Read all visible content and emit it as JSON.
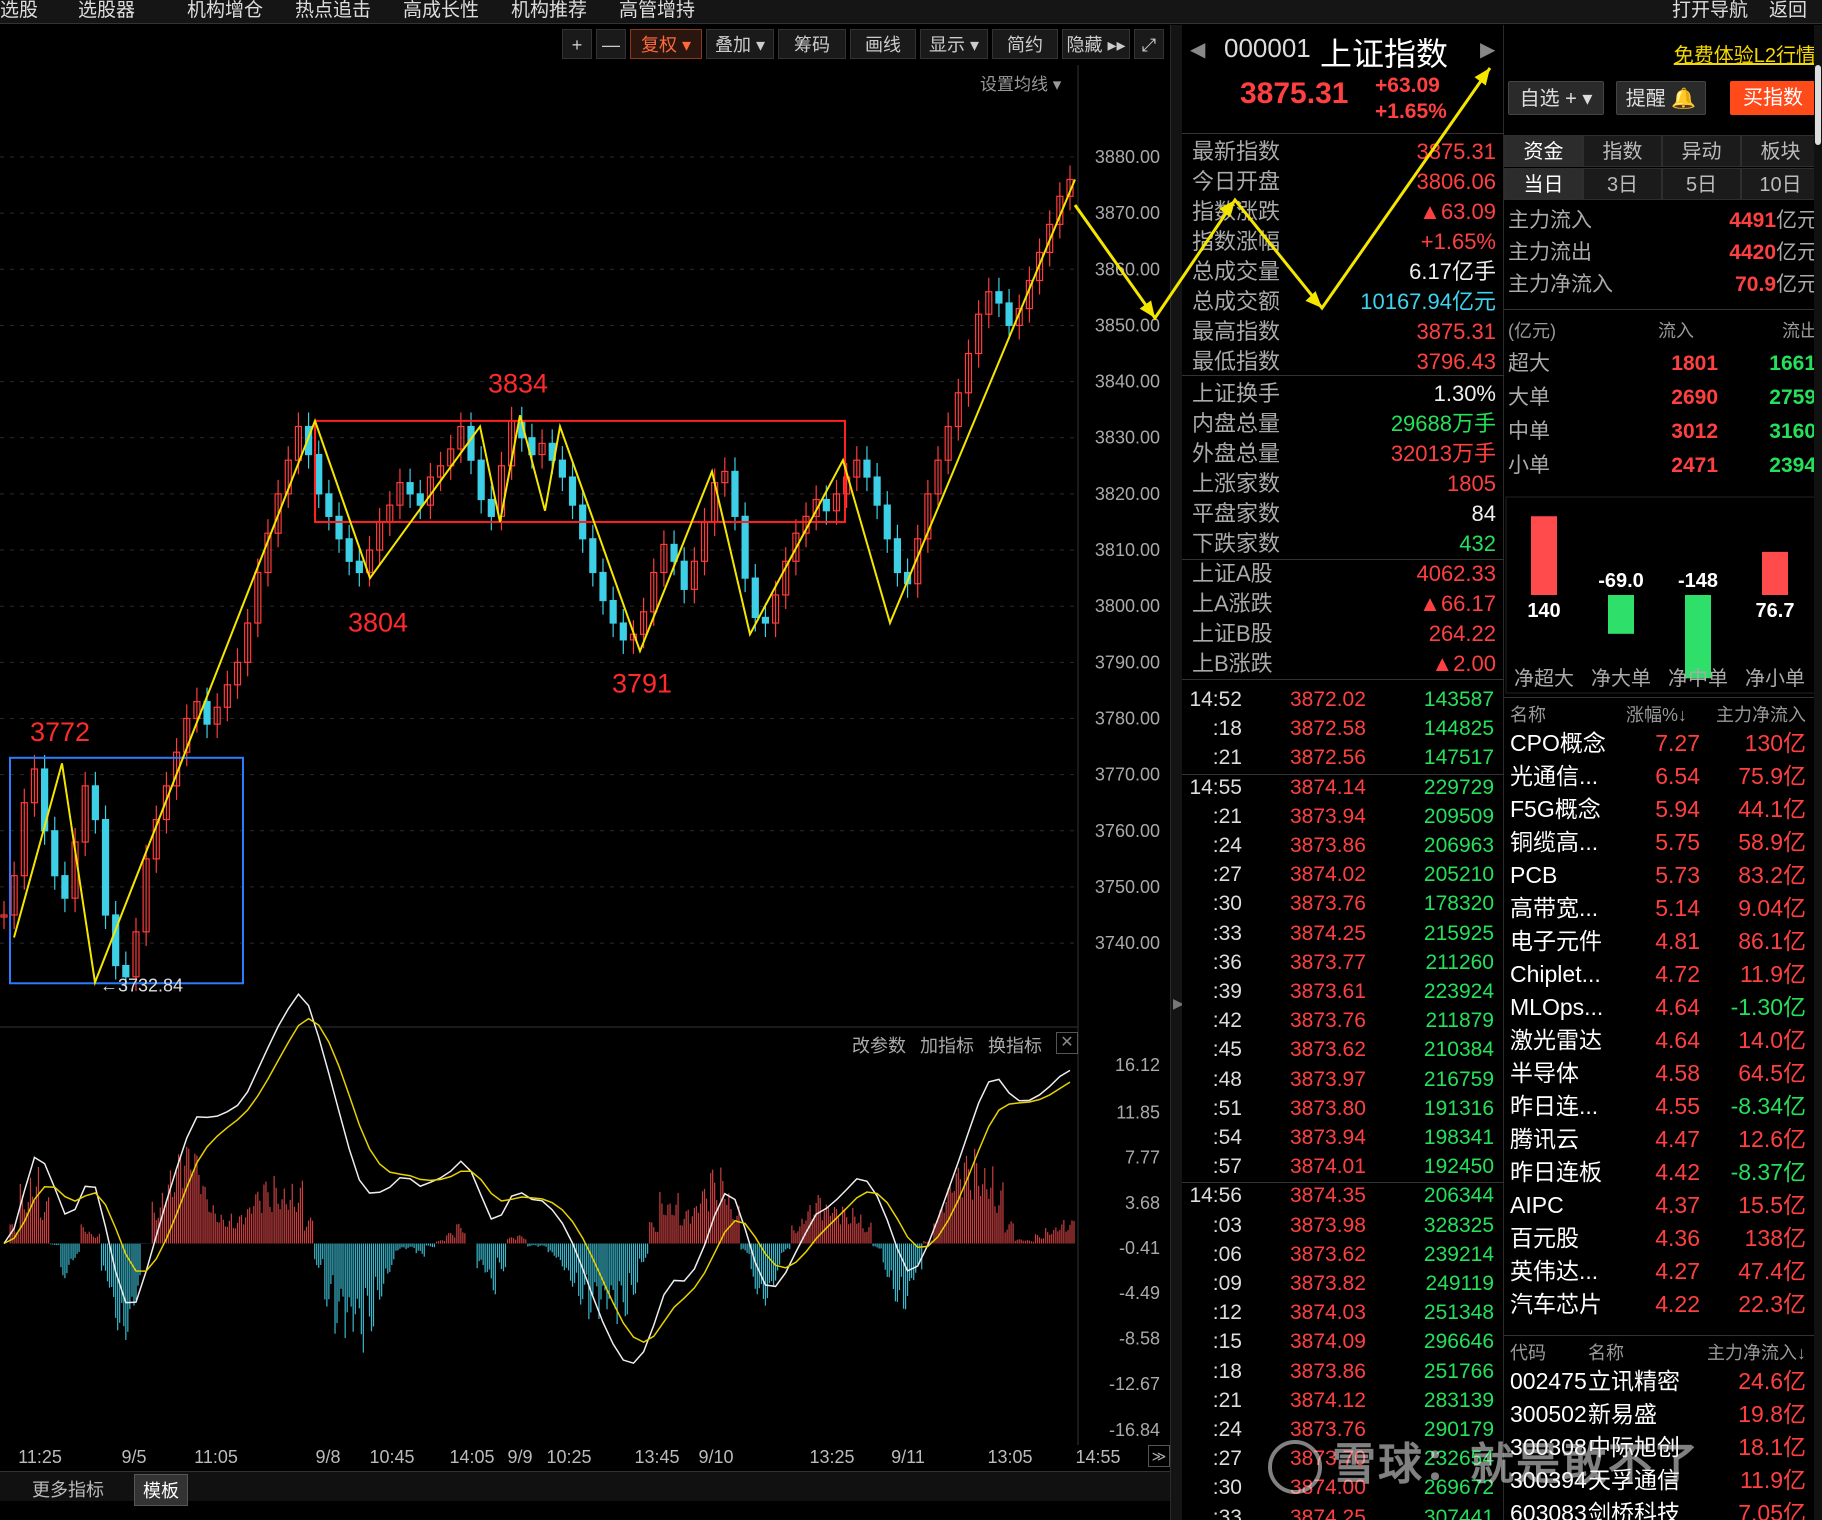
{
  "nav": {
    "items": [
      "选股",
      "选股器",
      "机构增仓",
      "热点追击",
      "高成长性",
      "机构推荐",
      "高管增持"
    ],
    "right": [
      "打开导航",
      "返回"
    ]
  },
  "toolbar": {
    "plus": "+",
    "minus": "—",
    "fuquan": "复权 ▾",
    "overlay": "叠加 ▾",
    "chips": "筹码",
    "draw": "画线",
    "display": "显示 ▾",
    "simple": "简约",
    "hide": "隐藏 ▸▸",
    "ma_settings": "设置均线 ▾"
  },
  "indicator_bar": {
    "edit": "改参数",
    "add": "加指标",
    "swap": "换指标"
  },
  "bottom_tabs": {
    "more": "更多指标",
    "template": "模板"
  },
  "chart_data": [
    {
      "type": "candlestick",
      "price_axis_ticks": [
        "3880.00",
        "3870.00",
        "3860.00",
        "3850.00",
        "3840.00",
        "3830.00",
        "3820.00",
        "3810.00",
        "3800.00",
        "3790.00",
        "3780.00",
        "3770.00",
        "3760.00",
        "3750.00",
        "3740.00"
      ],
      "ylim": [
        3732,
        3880
      ],
      "time_axis_labels": [
        "11:25",
        "9/5",
        "11:05",
        "9/8",
        "10:45",
        "14:05",
        "9/9",
        "10:25",
        "13:45",
        "9/10",
        "13:25",
        "9/11",
        "13:05",
        "14:55"
      ],
      "min_marker": "3732.84",
      "annotations": [
        "3772",
        "3834",
        "3804",
        "3791"
      ],
      "pivot_points": [
        3741,
        3772,
        3733,
        3833,
        3805,
        3832,
        3815,
        3834,
        3817,
        3832,
        3792,
        3824,
        3795,
        3826,
        3797,
        3876,
        3860,
        3866,
        3858,
        3880
      ],
      "price_series": [
        3745,
        3752,
        3765,
        3771,
        3760,
        3752,
        3748,
        3758,
        3768,
        3762,
        3745,
        3736,
        3734,
        3742,
        3755,
        3762,
        3768,
        3774,
        3780,
        3783,
        3779,
        3782,
        3786,
        3790,
        3797,
        3806,
        3813,
        3820,
        3826,
        3832,
        3827,
        3820,
        3816,
        3812,
        3808,
        3806,
        3810,
        3815,
        3818,
        3822,
        3820,
        3818,
        3823,
        3825,
        3828,
        3832,
        3826,
        3819,
        3816,
        3825,
        3833,
        3830,
        3827,
        3829,
        3826,
        3823,
        3818,
        3812,
        3806,
        3801,
        3797,
        3794,
        3795,
        3799,
        3806,
        3811,
        3808,
        3803,
        3808,
        3815,
        3822,
        3824,
        3816,
        3805,
        3798,
        3797,
        3802,
        3808,
        3813,
        3816,
        3819,
        3817,
        3820,
        3823,
        3826,
        3823,
        3818,
        3812,
        3806,
        3804,
        3812,
        3820,
        3826,
        3832,
        3838,
        3845,
        3852,
        3856,
        3854,
        3850,
        3853,
        3858,
        3863,
        3868,
        3873,
        3876
      ]
    },
    {
      "type": "macd",
      "axis_ticks": [
        "16.12",
        "11.85",
        "7.77",
        "3.68",
        "-0.41",
        "-4.49",
        "-8.58",
        "-12.67",
        "-16.84"
      ],
      "ylim": [
        -16.84,
        16.12
      ]
    },
    {
      "type": "bar",
      "title": "",
      "categories": [
        "净超大",
        "净大单",
        "净中单",
        "净小单"
      ],
      "values": [
        140,
        -69.0,
        -148,
        76.7
      ],
      "labels": [
        "140",
        "-69.0",
        "-148",
        "76.7"
      ]
    }
  ],
  "quote": {
    "code": "000001",
    "name": "上证指数",
    "price": "3875.31",
    "change": "+63.09",
    "change_pct": "+1.65%",
    "rows": [
      {
        "label": "最新指数",
        "value": "3875.31",
        "color": "red"
      },
      {
        "label": "今日开盘",
        "value": "3806.06",
        "color": "red"
      },
      {
        "label": "指数涨跌",
        "value": "▲63.09",
        "color": "red"
      },
      {
        "label": "指数涨幅",
        "value": "+1.65%",
        "color": "red"
      },
      {
        "label": "总成交量",
        "value": "6.17亿手",
        "color": "white"
      },
      {
        "label": "总成交额",
        "value": "10167.94亿元",
        "color": "cyan"
      },
      {
        "label": "最高指数",
        "value": "3875.31",
        "color": "red"
      },
      {
        "label": "最低指数",
        "value": "3796.43",
        "color": "red"
      },
      {
        "label": "上证换手",
        "value": "1.30%",
        "color": "white"
      },
      {
        "label": "内盘总量",
        "value": "29688万手",
        "color": "green"
      },
      {
        "label": "外盘总量",
        "value": "32013万手",
        "color": "red"
      },
      {
        "label": "上涨家数",
        "value": "1805",
        "color": "red"
      },
      {
        "label": "平盘家数",
        "value": "84",
        "color": "white"
      },
      {
        "label": "下跌家数",
        "value": "432",
        "color": "green"
      },
      {
        "label": "上证A股",
        "value": "4062.33",
        "color": "red"
      },
      {
        "label": "上A涨跌",
        "value": "▲66.17",
        "color": "red"
      },
      {
        "label": "上证B股",
        "value": "264.22",
        "color": "red"
      },
      {
        "label": "上B涨跌",
        "value": "▲2.00",
        "color": "red"
      }
    ],
    "ticks": [
      {
        "t": "14:52",
        "p": "3872.02",
        "v": "143587"
      },
      {
        "t": ":18",
        "p": "3872.58",
        "v": "144825"
      },
      {
        "t": ":21",
        "p": "3872.56",
        "v": "147517"
      },
      {
        "t": "14:55",
        "p": "3874.14",
        "v": "229729"
      },
      {
        "t": ":21",
        "p": "3873.94",
        "v": "209509"
      },
      {
        "t": ":24",
        "p": "3873.86",
        "v": "206963"
      },
      {
        "t": ":27",
        "p": "3874.02",
        "v": "205210"
      },
      {
        "t": ":30",
        "p": "3873.76",
        "v": "178320"
      },
      {
        "t": ":33",
        "p": "3874.25",
        "v": "215925"
      },
      {
        "t": ":36",
        "p": "3873.77",
        "v": "211260"
      },
      {
        "t": ":39",
        "p": "3873.61",
        "v": "223924"
      },
      {
        "t": ":42",
        "p": "3873.76",
        "v": "211879"
      },
      {
        "t": ":45",
        "p": "3873.62",
        "v": "210384"
      },
      {
        "t": ":48",
        "p": "3873.97",
        "v": "216759"
      },
      {
        "t": ":51",
        "p": "3873.80",
        "v": "191316"
      },
      {
        "t": ":54",
        "p": "3873.94",
        "v": "198341"
      },
      {
        "t": ":57",
        "p": "3874.01",
        "v": "192450"
      },
      {
        "t": "14:56",
        "p": "3874.35",
        "v": "206344"
      },
      {
        "t": ":03",
        "p": "3873.98",
        "v": "328325"
      },
      {
        "t": ":06",
        "p": "3873.62",
        "v": "239214"
      },
      {
        "t": ":09",
        "p": "3873.82",
        "v": "249119"
      },
      {
        "t": ":12",
        "p": "3874.03",
        "v": "251348"
      },
      {
        "t": ":15",
        "p": "3874.09",
        "v": "296646"
      },
      {
        "t": ":18",
        "p": "3873.86",
        "v": "251766"
      },
      {
        "t": ":21",
        "p": "3874.12",
        "v": "283139"
      },
      {
        "t": ":24",
        "p": "3873.76",
        "v": "290179"
      },
      {
        "t": ":27",
        "p": "3873.70",
        "v": "232654"
      },
      {
        "t": ":30",
        "p": "3874.00",
        "v": "269672"
      },
      {
        "t": ":33",
        "p": "3874.25",
        "v": "307441"
      }
    ]
  },
  "fund": {
    "l2_link": "免费体验L2行情",
    "watch_btn": "自选 + ▾",
    "alert_btn": "提醒 🔔",
    "buy_btn": "买指数",
    "tabs_top": [
      "资金",
      "指数",
      "异动",
      "板块"
    ],
    "tabs_period": [
      "当日",
      "3日",
      "5日",
      "10日"
    ],
    "flows": [
      {
        "label": "主力流入",
        "value": "4491",
        "unit": "亿元"
      },
      {
        "label": "主力流出",
        "value": "4420",
        "unit": "亿元"
      },
      {
        "label": "主力净流入",
        "value": "70.9",
        "unit": "亿元"
      }
    ],
    "size_header": {
      "unit": "(亿元)",
      "in": "流入",
      "out": "流出"
    },
    "sizes": [
      {
        "label": "超大",
        "in": "1801",
        "out": "1661"
      },
      {
        "label": "大单",
        "in": "2690",
        "out": "2759"
      },
      {
        "label": "中单",
        "in": "3012",
        "out": "3160"
      },
      {
        "label": "小单",
        "in": "2471",
        "out": "2394"
      }
    ],
    "sector_header": {
      "name": "名称",
      "pct": "涨幅%↓",
      "flow": "主力净流入"
    },
    "sectors": [
      {
        "name": "CPO概念",
        "pct": "7.27",
        "flow": "130亿",
        "color": "red"
      },
      {
        "name": "光通信...",
        "pct": "6.54",
        "flow": "75.9亿",
        "color": "red"
      },
      {
        "name": "F5G概念",
        "pct": "5.94",
        "flow": "44.1亿",
        "color": "red"
      },
      {
        "name": "铜缆高...",
        "pct": "5.75",
        "flow": "58.9亿",
        "color": "red"
      },
      {
        "name": "PCB",
        "pct": "5.73",
        "flow": "83.2亿",
        "color": "red"
      },
      {
        "name": "高带宽...",
        "pct": "5.14",
        "flow": "9.04亿",
        "color": "red"
      },
      {
        "name": "电子元件",
        "pct": "4.81",
        "flow": "86.1亿",
        "color": "red"
      },
      {
        "name": "Chiplet...",
        "pct": "4.72",
        "flow": "11.9亿",
        "color": "red"
      },
      {
        "name": "MLOps...",
        "pct": "4.64",
        "flow": "-1.30亿",
        "color": "green"
      },
      {
        "name": "激光雷达",
        "pct": "4.64",
        "flow": "14.0亿",
        "color": "red"
      },
      {
        "name": "半导体",
        "pct": "4.58",
        "flow": "64.5亿",
        "color": "red"
      },
      {
        "name": "昨日连...",
        "pct": "4.55",
        "flow": "-8.34亿",
        "color": "green"
      },
      {
        "name": "腾讯云",
        "pct": "4.47",
        "flow": "12.6亿",
        "color": "red"
      },
      {
        "name": "昨日连板",
        "pct": "4.42",
        "flow": "-8.37亿",
        "color": "green"
      },
      {
        "name": "AIPC",
        "pct": "4.37",
        "flow": "15.5亿",
        "color": "red"
      },
      {
        "name": "百元股",
        "pct": "4.36",
        "flow": "138亿",
        "color": "red"
      },
      {
        "name": "英伟达...",
        "pct": "4.27",
        "flow": "47.4亿",
        "color": "red"
      },
      {
        "name": "汽车芯片",
        "pct": "4.22",
        "flow": "22.3亿",
        "color": "red"
      }
    ],
    "stock_header": {
      "code": "代码",
      "name": "名称",
      "flow": "主力净流入↓"
    },
    "stocks": [
      {
        "code": "002475",
        "name": "立讯精密",
        "flow": "24.6亿"
      },
      {
        "code": "300502",
        "name": "新易盛",
        "flow": "19.8亿"
      },
      {
        "code": "300308",
        "name": "中际旭创",
        "flow": "18.1亿"
      },
      {
        "code": "300394",
        "name": "天孚通信",
        "flow": "11.9亿"
      },
      {
        "code": "603083",
        "name": "剑桥科技",
        "flow": "7.05亿"
      }
    ]
  },
  "watermark": "雪球：就是敢不了"
}
